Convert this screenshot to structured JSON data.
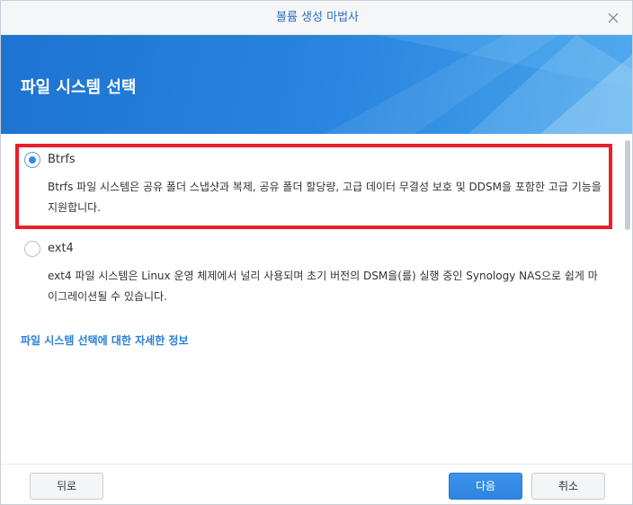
{
  "window": {
    "title": "볼륨 생성 마법사"
  },
  "banner": {
    "title": "파일 시스템 선택"
  },
  "options": [
    {
      "label": "Btrfs",
      "selected": true,
      "description": "Btrfs 파일 시스템은 공유 폴더 스냅샷과 복제, 공유 폴더 할당량, 고급 데이터 무결성 보호 및 DDSM을 포함한 고급 기능을 지원합니다."
    },
    {
      "label": "ext4",
      "selected": false,
      "description": "ext4 파일 시스템은 Linux 운영 체제에서 널리 사용되며 초기 버전의 DSM을(를) 실행 중인 Synology NAS으로 쉽게 마이그레이션될 수 있습니다."
    }
  ],
  "more_info_link": "파일 시스템 선택에 대한 자세한 정보",
  "footer": {
    "back_label": "뒤로",
    "next_label": "다음",
    "cancel_label": "취소"
  },
  "colors": {
    "accent": "#2f84e0",
    "highlight": "#e8202a"
  },
  "icons": {
    "close": "close-icon"
  }
}
